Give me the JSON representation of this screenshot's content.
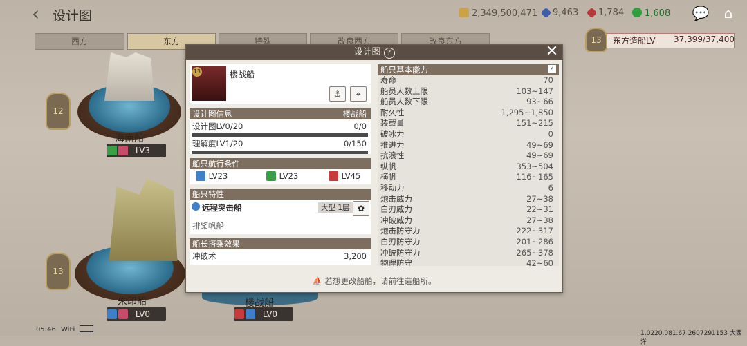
{
  "header": {
    "title": "设计图"
  },
  "resources": {
    "gold": "2,349,500,471",
    "blue_gem": "9,463",
    "red_gem": "1,784",
    "green": "1,608"
  },
  "tabs": [
    "西方",
    "东方",
    "特殊",
    "改良西方",
    "改良东方"
  ],
  "shipyard": {
    "label": "东方造船LV",
    "value": "37,399/37,400",
    "level": "13"
  },
  "ships": [
    {
      "name": "海南船",
      "lv": "LV3",
      "badge": "12"
    },
    {
      "name": "朱印船",
      "lv": "LV0",
      "badge": "13"
    },
    {
      "name": "楼战船",
      "lv": "LV0"
    }
  ],
  "modal": {
    "title": "设计图",
    "ship_name": "楼战船",
    "ship_badge": "13",
    "info": {
      "header": "设计图信息",
      "header_value": "楼战船",
      "r1_label": "设计图LV0/20",
      "r1_value": "0/0",
      "r2_label": "理解度LV1/20",
      "r2_value": "0/150"
    },
    "conditions": {
      "header": "船只航行条件",
      "c1": "LV23",
      "c2": "LV23",
      "c3": "LV45"
    },
    "traits": {
      "header": "船只特性",
      "trait_name": "远程突击船",
      "size": "大型 1层",
      "desc": "排桨帆船"
    },
    "captain": {
      "header": "船长搭乘效果",
      "effect": "冲破术",
      "value": "3,200"
    },
    "stats_header": "船只基本能力",
    "stats": [
      {
        "k": "寿命",
        "v": "70"
      },
      {
        "k": "船员人数上限",
        "v": "103~147"
      },
      {
        "k": "船员人数下限",
        "v": "93~66"
      },
      {
        "k": "耐久性",
        "v": "1,295~1,850"
      },
      {
        "k": "装载量",
        "v": "151~215"
      },
      {
        "k": "破冰力",
        "v": "0"
      },
      {
        "k": "推进力",
        "v": "49~69"
      },
      {
        "k": "抗浪性",
        "v": "49~69"
      },
      {
        "k": "纵帆",
        "v": "353~504"
      },
      {
        "k": "横帆",
        "v": "116~165"
      },
      {
        "k": "移动力",
        "v": "6"
      },
      {
        "k": "炮击威力",
        "v": "27~38"
      },
      {
        "k": "白刃威力",
        "v": "22~31"
      },
      {
        "k": "冲破威力",
        "v": "27~38"
      },
      {
        "k": "炮击防守力",
        "v": "222~317"
      },
      {
        "k": "白刃防守力",
        "v": "201~286"
      },
      {
        "k": "冲破防守力",
        "v": "265~378"
      },
      {
        "k": "物理防守",
        "v": "42~60"
      }
    ],
    "footer": "若想更改船舶，请前往造船所。"
  },
  "status": {
    "time": "05:46",
    "wifi": "WiFi",
    "version": "1.0220.081.67 2607291153 大西洋"
  },
  "colors": {
    "accent": "#5a4e44",
    "section": "#7d6e60"
  }
}
